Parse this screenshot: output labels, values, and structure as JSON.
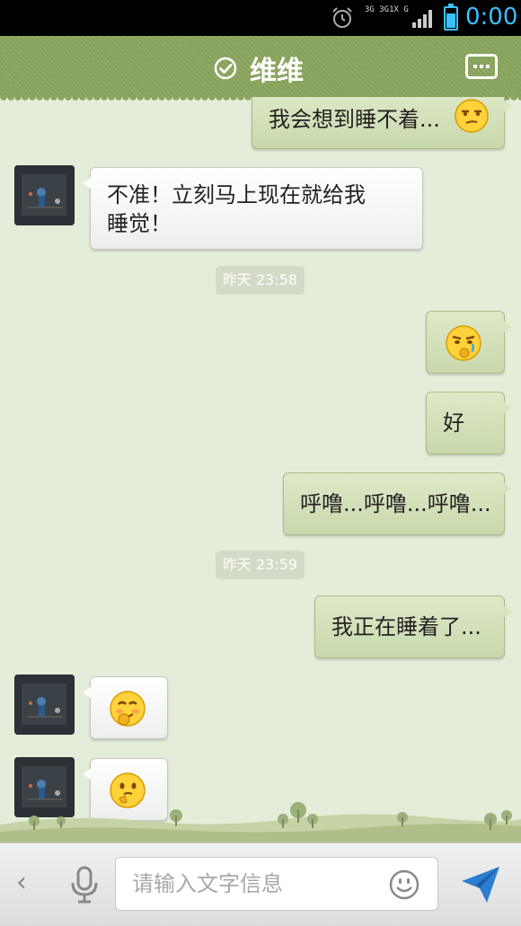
{
  "status_bar": {
    "network_label_1": "3G 3G1X G",
    "time": "0:00",
    "accent_color": "#3ac0ff",
    "battery_level": 0.7
  },
  "header": {
    "title": "维维",
    "verified_icon": "check-circle-icon",
    "menu_icon": "chat-bubble-dots-icon"
  },
  "messages": [
    {
      "side": "out",
      "text": "我会想到睡不着...",
      "emoji": "smirk-emoji"
    },
    {
      "side": "in",
      "text": "不准！立刻马上现在就给我睡觉！"
    },
    {
      "type": "timestamp",
      "text": "昨天 23:58"
    },
    {
      "side": "out",
      "emoji": "crying-emoji"
    },
    {
      "side": "out",
      "text": "好"
    },
    {
      "side": "out",
      "text": "呼噜...呼噜...呼噜..."
    },
    {
      "type": "timestamp",
      "text": "昨天 23:59"
    },
    {
      "side": "out",
      "text": "我正在睡着了..."
    },
    {
      "side": "in",
      "emoji": "shy-smile-emoji"
    },
    {
      "side": "in",
      "emoji": "thinking-emoji"
    }
  ],
  "bubbles": {
    "m1": "我会想到睡不着...",
    "m2_line1": "不准！立刻马上现在就给我",
    "m2_line2": "睡觉！",
    "ts1": "昨天 23:58",
    "m5": "好",
    "m6": "呼噜...呼噜...呼噜...",
    "ts2": "昨天 23:59",
    "m7": "我正在睡着了..."
  },
  "input_bar": {
    "back_glyph": "‹",
    "placeholder": "请输入文字信息",
    "value": ""
  },
  "colors": {
    "header": "#8aa65e",
    "chat_background": "#e4edd9",
    "out_bubble": "#d3e0b6",
    "in_bubble": "#ffffff",
    "send_icon": "#2b7fd0"
  }
}
